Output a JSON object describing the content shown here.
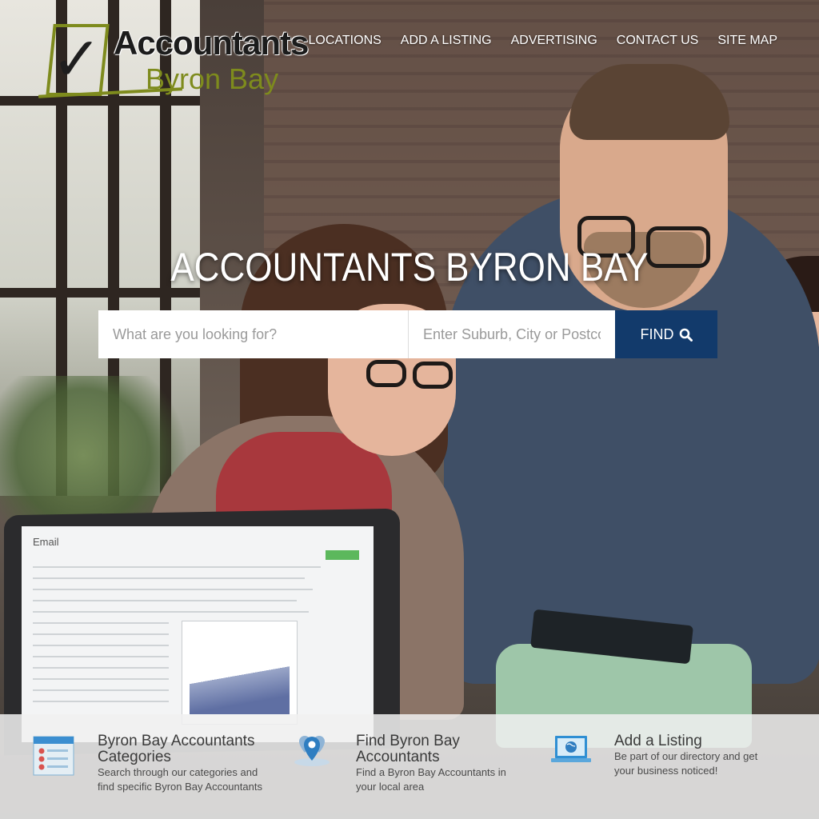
{
  "header": {
    "logo": {
      "title": "Accountants",
      "subtitle": "Byron Bay"
    },
    "nav": [
      {
        "label": "LOCATIONS"
      },
      {
        "label": "ADD A LISTING"
      },
      {
        "label": "ADVERTISING"
      },
      {
        "label": "CONTACT US"
      },
      {
        "label": "SITE MAP"
      }
    ]
  },
  "hero": {
    "title": "ACCOUNTANTS BYRON BAY",
    "search": {
      "what_placeholder": "What are you looking for?",
      "where_placeholder": "Enter Suburb, City or Postcode",
      "button_label": "FIND",
      "button_icon": "search-icon"
    }
  },
  "laptop_screen": {
    "app_title": "Email"
  },
  "features": [
    {
      "title": "Byron Bay Accountants Categories",
      "text": "Search through our categories and find specific Byron Bay Accountants",
      "icon": "checklist-icon"
    },
    {
      "title": "Find Byron Bay Accountants",
      "text": "Find a Byron Bay Accountants in your local area",
      "icon": "location-pins-icon"
    },
    {
      "title": "Add a Listing",
      "text": "Be part of our directory and get your business noticed!",
      "icon": "laptop-globe-icon"
    }
  ],
  "colors": {
    "logo_green": "#7e8b1d",
    "button_navy": "#123a6b",
    "strip_bg": "#f0f0f0"
  }
}
